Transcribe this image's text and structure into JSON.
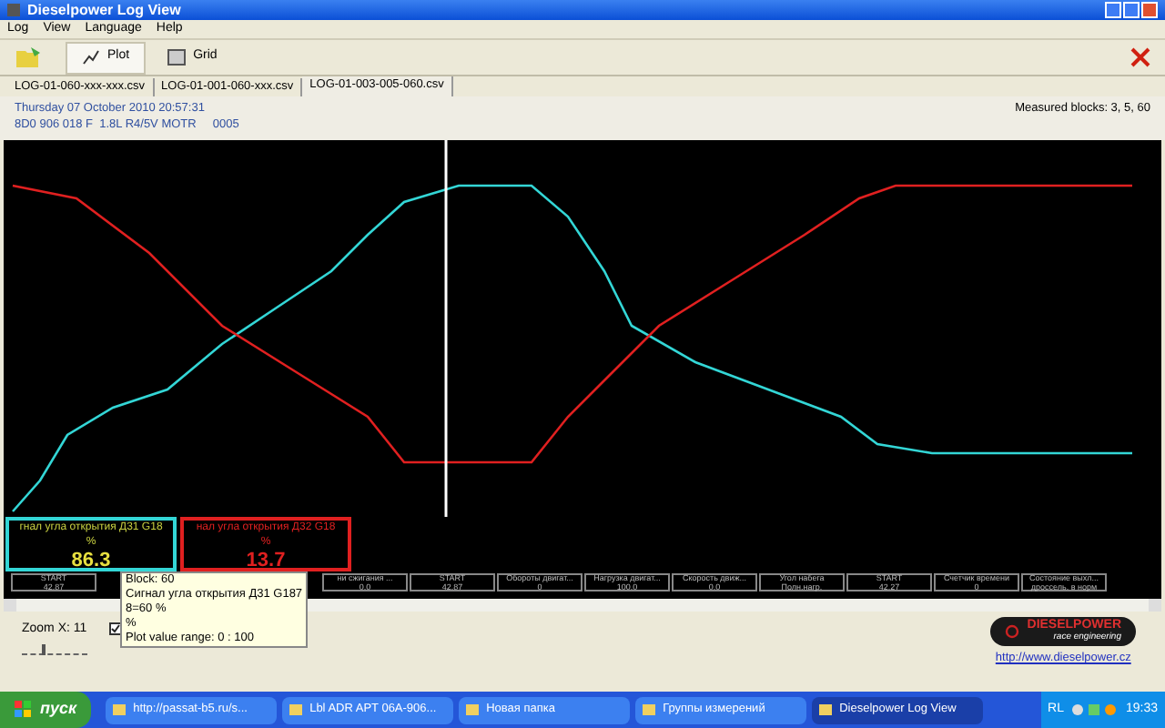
{
  "window": {
    "title": "Dieselpower Log View"
  },
  "menu": [
    "Log",
    "View",
    "Language",
    "Help"
  ],
  "toolbar": [
    {
      "label": "Plot",
      "selected": true
    },
    {
      "label": "Grid",
      "selected": false
    }
  ],
  "file_tabs": [
    {
      "label": "LOG-01-060-xxx-xxx.csv",
      "selected": false
    },
    {
      "label": "LOG-01-001-060-xxx.csv",
      "selected": false
    },
    {
      "label": "LOG-01-003-005-060.csv",
      "selected": true
    }
  ],
  "info": {
    "date": "Thursday 07 October 2010 20:57:31",
    "ecu": "8D0 906 018 F  1.8L R4/5V MOTR     0005",
    "measured": "Measured blocks: 3, 5, 60"
  },
  "legend": [
    {
      "label": "гнал угла открытия Д31 G18",
      "unit": "%",
      "value": "86.3",
      "color": "#33d6d6"
    },
    {
      "label": "нал угла открытия Д32 G18",
      "unit": "%",
      "value": "13.7",
      "color": "#e02020"
    }
  ],
  "blocks": [
    {
      "name": "START",
      "value": "42.87"
    },
    {
      "kind": "covered"
    },
    {
      "kind": "covered"
    },
    {
      "kind": "covered"
    },
    {
      "name": "ни сжигания ...",
      "value": "0.0"
    },
    {
      "name": "START",
      "value": "42.87"
    },
    {
      "name": "Обороты двигат...",
      "value": "0"
    },
    {
      "name": "Нагрузка двигат...",
      "value": "100.0"
    },
    {
      "name": "Скорость движ...",
      "value": "0.0"
    },
    {
      "name": "Угол набега",
      "value": "Полн.нагр."
    },
    {
      "name": "START",
      "value": "42.27"
    },
    {
      "name": "Счетчик времени",
      "value": "0"
    },
    {
      "name": "Состояние выхл...",
      "value": "дроссель. в норм"
    }
  ],
  "tooltip": [
    "Block: 60",
    "Сигнал угла открытия Д31 G187",
    "8=60 %",
    "%",
    "Plot value range: 0 : 100"
  ],
  "zoom": {
    "label": "Zoom X: 11",
    "level": 0.3
  },
  "plot_checkbox": {
    "checked": true
  },
  "link": "http://www.dieselpower.cz",
  "logo": {
    "name": "DIESELPOWER",
    "tagline": "race engineering"
  },
  "taskbar": {
    "start": "пуск",
    "items": [
      {
        "label": "http://passat-b5.ru/s...",
        "selected": false
      },
      {
        "label": "Lbl ADR APT 06A-906...",
        "selected": false
      },
      {
        "label": "Новая папка",
        "selected": false
      },
      {
        "label": "Группы измерений",
        "selected": false
      },
      {
        "label": "Dieselpower Log View",
        "selected": true
      }
    ],
    "lang": "RL",
    "clock": "19:33"
  }
}
